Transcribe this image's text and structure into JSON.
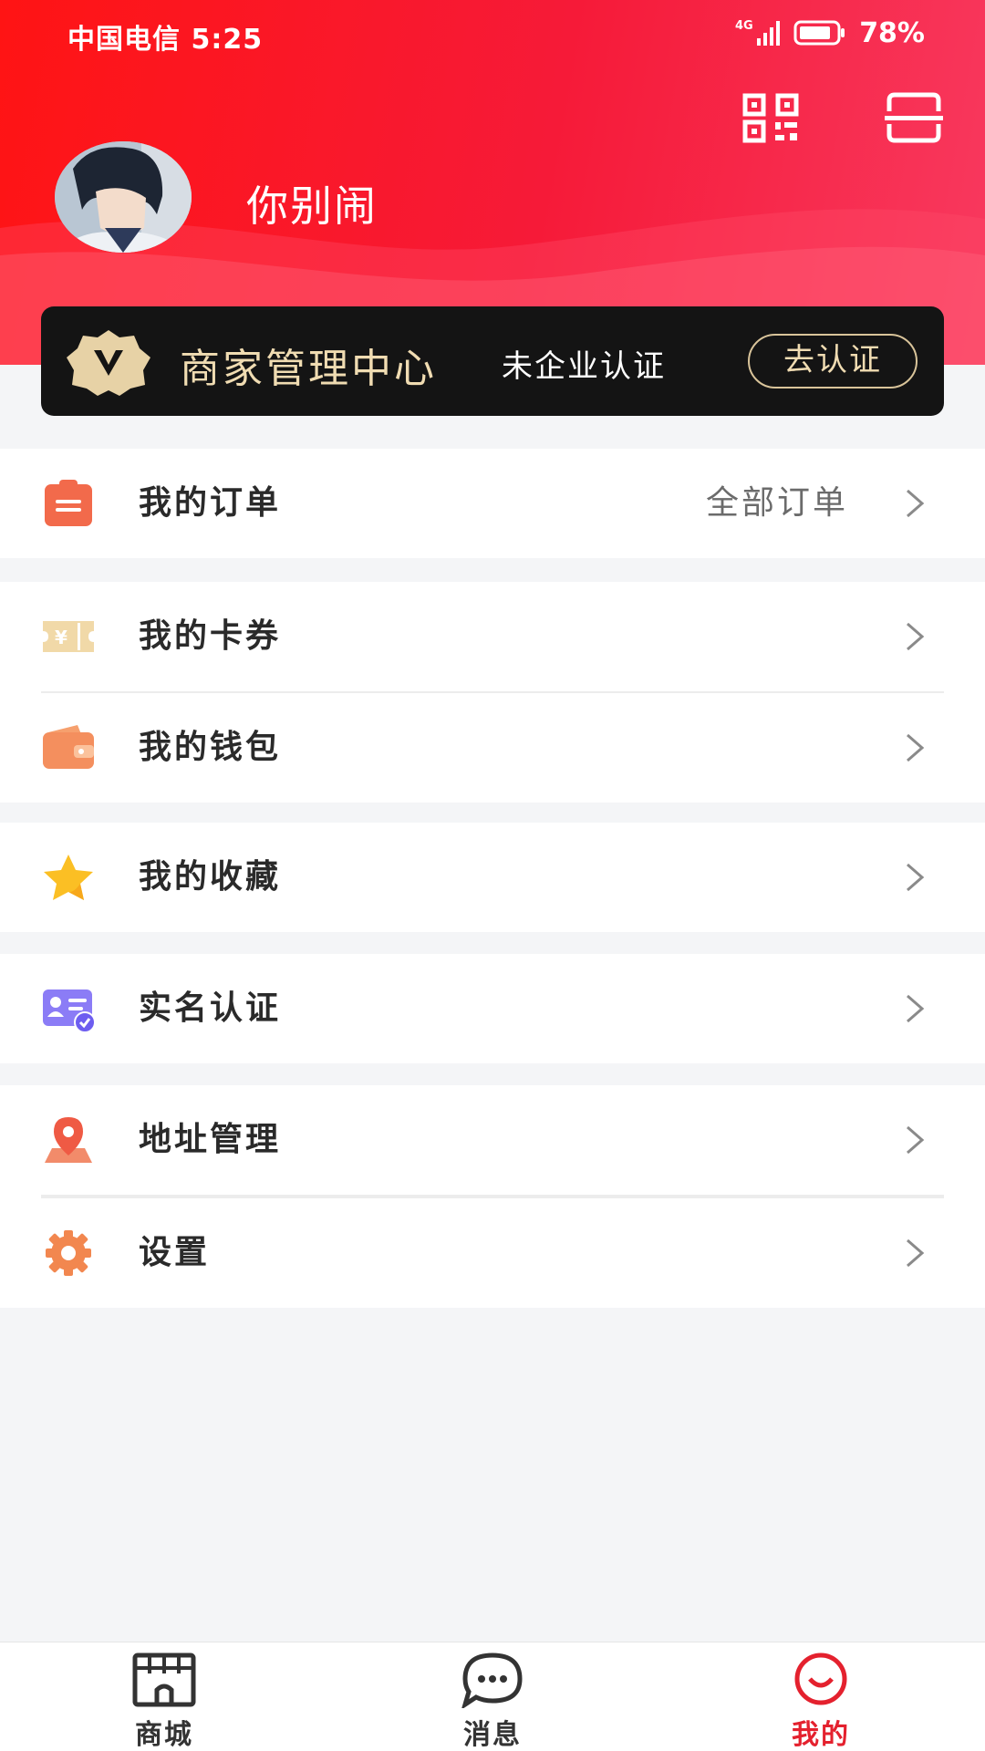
{
  "status_bar": {
    "carrier_time": "中国电信 5:25",
    "network": "4G",
    "battery": "78%"
  },
  "header": {
    "username": "你别闹",
    "actions": [
      "qr-code-icon",
      "scan-icon"
    ],
    "gradient": [
      "#ff1414",
      "#f8395f"
    ]
  },
  "merchant": {
    "title": "商家管理中心",
    "status": "未企业认证",
    "button": "去认证",
    "badge_icon": "vip-badge-icon"
  },
  "menu": {
    "orders": {
      "label": "我的订单",
      "extra": "全部订单",
      "icon": "order-icon"
    },
    "coupons": {
      "label": "我的卡券",
      "icon": "coupon-icon"
    },
    "wallet": {
      "label": "我的钱包",
      "icon": "wallet-icon"
    },
    "favorites": {
      "label": "我的收藏",
      "icon": "star-icon"
    },
    "verification": {
      "label": "实名认证",
      "icon": "id-card-icon"
    },
    "address": {
      "label": "地址管理",
      "icon": "location-icon"
    },
    "settings": {
      "label": "设置",
      "icon": "gear-icon"
    }
  },
  "tabs": [
    {
      "label": "商城",
      "icon": "store-icon",
      "active": false
    },
    {
      "label": "消息",
      "icon": "message-icon",
      "active": false
    },
    {
      "label": "我的",
      "icon": "profile-smile-icon",
      "active": true
    }
  ],
  "colors": {
    "accent": "#e4212e",
    "card_bg": "#141414",
    "gold": "#f0dcb2"
  }
}
